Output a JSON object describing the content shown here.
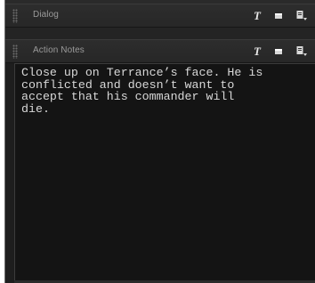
{
  "panels": [
    {
      "title": "Dialog",
      "icons": {
        "text": "T",
        "window": "window-icon",
        "export": "export-icon"
      }
    },
    {
      "title": "Action Notes",
      "icons": {
        "text": "T",
        "window": "window-icon",
        "export": "export-icon"
      }
    }
  ],
  "notes": {
    "content": "Close up on Terrance’s face. He is\nconflicted and doesn’t want to\naccept that his commander will\ndie."
  }
}
